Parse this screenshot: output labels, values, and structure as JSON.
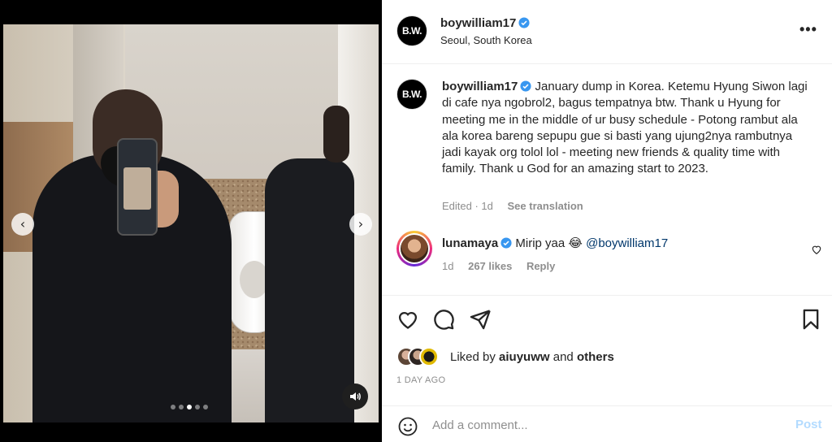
{
  "post": {
    "username": "boywilliam17",
    "location": "Seoul, South Korea",
    "avatar_text": "B.W."
  },
  "media": {
    "slide_count": 5,
    "active_slide": 3
  },
  "caption": {
    "username": "boywilliam17",
    "text": "January dump in Korea. Ketemu Hyung Siwon lagi di cafe nya ngobrol2, bagus tempatnya btw. Thank u Hyung for meeting me in the middle of ur busy schedule - Potong rambut ala ala korea bareng sepupu gue si basti yang ujung2nya rambutnya jadi kayak org tolol lol - meeting new friends & quality time with family. Thank u God for an amazing start to 2023.",
    "meta": "Edited · 1d",
    "see_translation": "See translation"
  },
  "comment": {
    "username": "lunamaya",
    "text": "Mirip yaa",
    "emoji": "😂",
    "mention": "@boywilliam17",
    "time": "1d",
    "likes": "267 likes",
    "reply": "Reply"
  },
  "likes": {
    "prefix": "Liked by",
    "user": "aiuyuww",
    "and": "and",
    "others": "others"
  },
  "time_ago": "1 DAY AGO",
  "add_comment": {
    "placeholder": "Add a comment...",
    "post_label": "Post"
  },
  "colors": {
    "verified": "#3897f0",
    "link": "#00376b",
    "post_disabled": "#b3dbff"
  },
  "icons": {
    "more": "more-icon",
    "like": "heart-icon",
    "comment": "comment-icon",
    "share": "share-icon",
    "save": "bookmark-icon",
    "emoji": "emoji-icon",
    "sound": "speaker-icon"
  }
}
